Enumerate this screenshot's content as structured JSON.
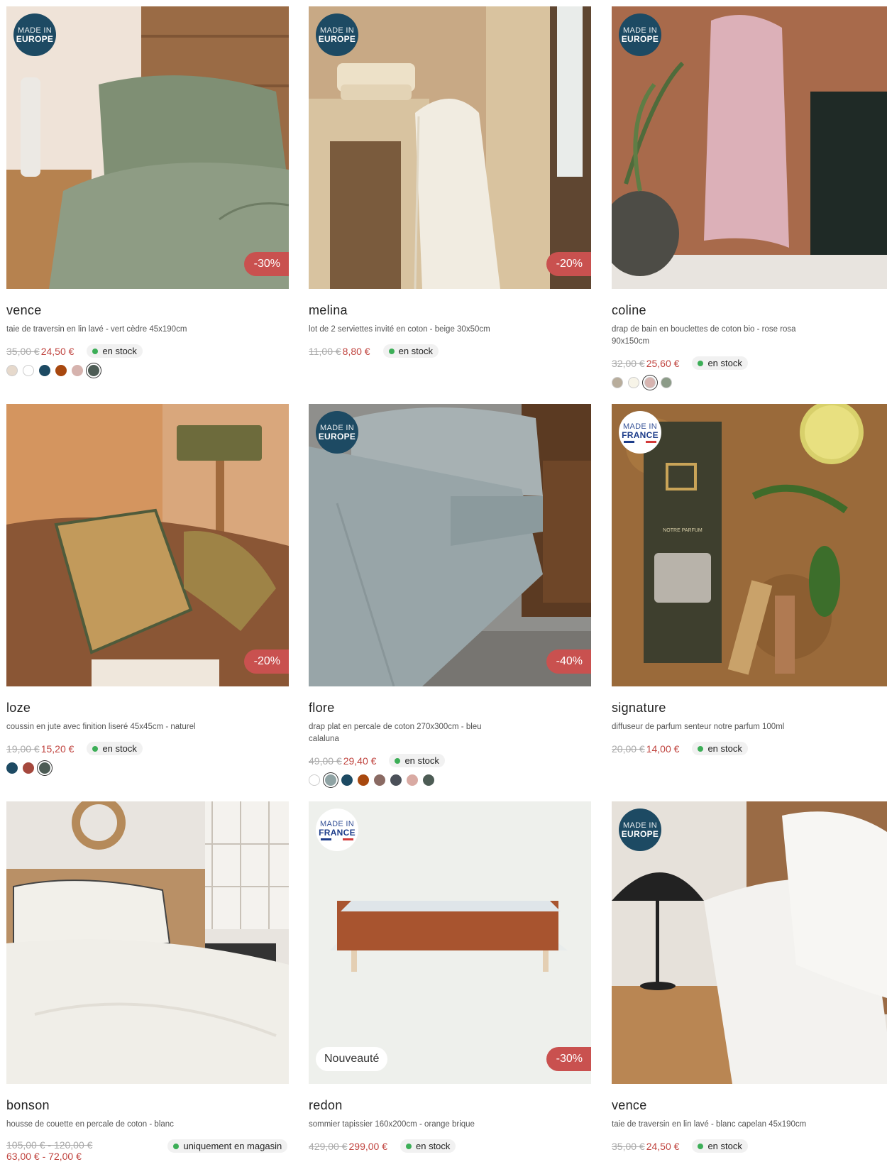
{
  "products": [
    {
      "title": "vence",
      "desc": "taie de traversin en lin lavé - vert cèdre 45x190cm",
      "old_price": "35,00 €",
      "new_price": "24,50 €",
      "stock": "en stock",
      "discount": "-30%",
      "origin": {
        "l1": "MADE IN",
        "l2": "EUROPE"
      },
      "swatches": [
        "#e6d9cc",
        "#ffffff",
        "#1d4a63",
        "#a8480f",
        "#d6b3ae",
        "#4d5c55"
      ]
    },
    {
      "title": "melina",
      "desc": "lot de 2 serviettes invité en coton - beige 30x50cm",
      "old_price": "11,00 €",
      "new_price": "8,80 €",
      "stock": "en stock",
      "discount": "-20%",
      "origin": {
        "l1": "MADE IN",
        "l2": "EUROPE"
      }
    },
    {
      "title": "coline",
      "desc": "drap de bain en bouclettes de coton bio - rose rosa 90x150cm",
      "old_price": "32,00 €",
      "new_price": "25,60 €",
      "stock": "en stock",
      "origin": {
        "l1": "MADE IN",
        "l2": "EUROPE"
      },
      "swatches": [
        "#b8ad9c",
        "#f7f4e8",
        "#d7b4b0",
        "#8c9b88"
      ]
    },
    {
      "title": "loze",
      "desc": "coussin en jute avec finition liseré 45x45cm - naturel",
      "old_price": "19,00 €",
      "new_price": "15,20 €",
      "stock": "en stock",
      "discount": "-20%",
      "swatches": [
        "#1d4a63",
        "#a5483d",
        "#4d5c55"
      ]
    },
    {
      "title": "flore",
      "desc": "drap plat en percale de coton 270x300cm - bleu calaluna",
      "old_price": "49,00 €",
      "new_price": "29,40 €",
      "stock": "en stock",
      "discount": "-40%",
      "origin": {
        "l1": "MADE IN",
        "l2": "EUROPE"
      },
      "swatches": [
        "#ffffff",
        "#8fa3a4",
        "#1d4a63",
        "#a8480f",
        "#8a6a63",
        "#4b5059",
        "#d9aaa3",
        "#4d5c55"
      ]
    },
    {
      "title": "signature",
      "desc": "diffuseur de parfum senteur notre parfum 100ml",
      "old_price": "20,00 €",
      "new_price": "14,00 €",
      "stock": "en stock",
      "origin": {
        "l1": "MADE IN",
        "l2": "FRANCE"
      },
      "box_label": "NOTRE PARFUM"
    },
    {
      "title": "bonson",
      "desc": "housse de couette en percale de coton - blanc",
      "old_price": "105,00 € - 120,00 €",
      "new_price": "63,00 € - 72,00 €",
      "stock": "uniquement en magasin"
    },
    {
      "title": "redon",
      "desc": "sommier tapissier 160x200cm - orange brique",
      "old_price": "429,00 €",
      "new_price": "299,00 €",
      "stock": "en stock",
      "discount": "-30%",
      "new_tag": "Nouveauté",
      "origin": {
        "l1": "MADE IN",
        "l2": "FRANCE"
      }
    },
    {
      "title": "vence",
      "desc": "taie de traversin en lin lavé - blanc capelan 45x190cm",
      "old_price": "35,00 €",
      "new_price": "24,50 €",
      "stock": "en stock",
      "origin": {
        "l1": "MADE IN",
        "l2": "EUROPE"
      }
    }
  ]
}
